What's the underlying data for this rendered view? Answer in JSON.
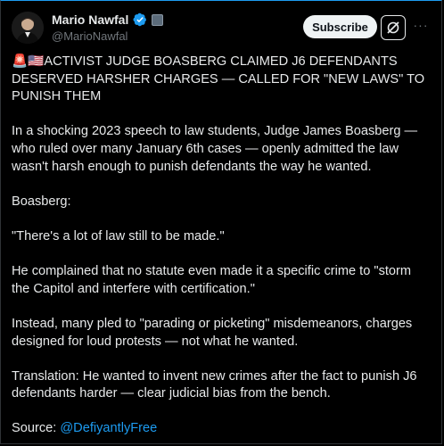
{
  "author": {
    "display_name": "Mario Nawfal",
    "handle": "@MarioNawfal",
    "verified_color": "#1d9bf0"
  },
  "actions": {
    "subscribe_label": "Subscribe",
    "grok_icon": "grok-icon",
    "more_label": "···"
  },
  "post": {
    "headline": "🚨🇺🇸ACTIVIST JUDGE BOASBERG CLAIMED J6 DEFENDANTS DESERVED HARSHER CHARGES — CALLED FOR \"NEW LAWS\" TO PUNISH THEM",
    "p1": "In a shocking 2023 speech to law students, Judge James Boasberg — who ruled over many January 6th cases — openly admitted the law wasn't harsh enough to punish defendants the way he wanted.",
    "p2": "Boasberg:",
    "p3": "\"There's a lot of law still to be made.\"",
    "p4": "He complained that no statute even made it a specific crime to \"storm the Capitol and interfere with certification.\"",
    "p5": "Instead, many pled to \"parading or picketing\" misdemeanors, charges designed for loud protests — not what he wanted.",
    "p6": "Translation: He wanted to invent new crimes after the fact to punish J6 defendants harder — clear judicial bias from the bench.",
    "source_label": "Source: ",
    "source_handle": "@DefiyantlyFree"
  }
}
